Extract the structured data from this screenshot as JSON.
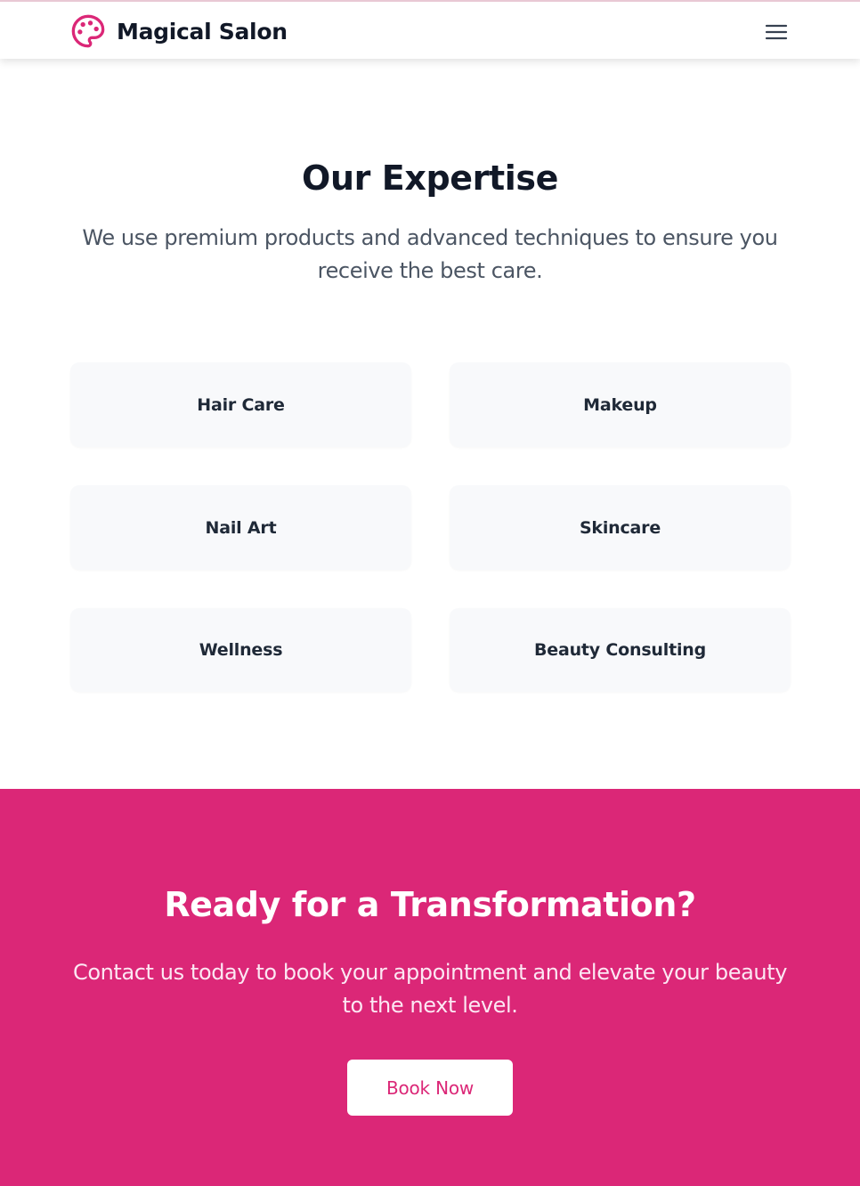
{
  "header": {
    "brand_name": "Magical Salon",
    "logo_icon": "palette-icon",
    "menu_icon": "hamburger-menu-icon"
  },
  "expertise": {
    "title": "Our Expertise",
    "description": "We use premium products and advanced techniques to ensure you receive the best care.",
    "services": [
      {
        "label": "Hair Care"
      },
      {
        "label": "Makeup"
      },
      {
        "label": "Nail Art"
      },
      {
        "label": "Skincare"
      },
      {
        "label": "Wellness"
      },
      {
        "label": "Beauty Consulting"
      }
    ]
  },
  "cta": {
    "title": "Ready for a Transformation?",
    "description": "Contact us today to book your appointment and elevate your beauty to the next level.",
    "button_label": "Book Now"
  },
  "colors": {
    "accent": "#db2777",
    "card_background": "#f8f9fb",
    "heading": "#111827",
    "body_text": "#4b5563",
    "header_top_border": "#e9c8d4"
  }
}
